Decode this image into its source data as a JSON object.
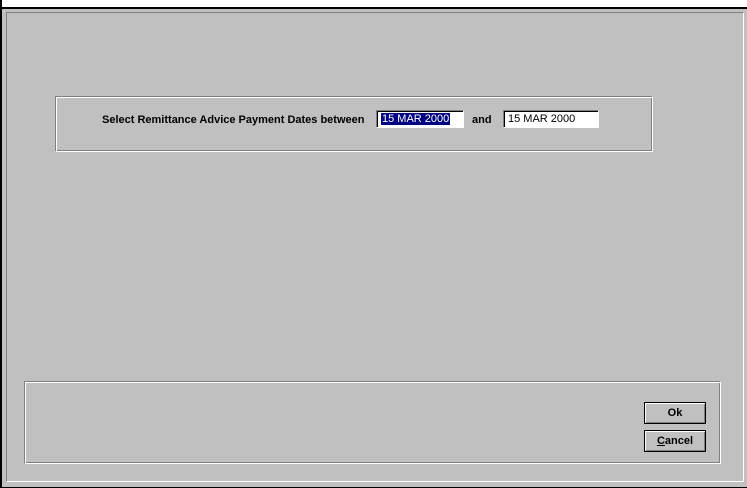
{
  "dialog": {
    "prompt": "Select Remittance Advice Payment Dates between",
    "and_label": "and",
    "date_from": "15 MAR 2000",
    "date_to": "15 MAR 2000"
  },
  "buttons": {
    "ok_label": "Ok",
    "cancel_first": "C",
    "cancel_rest": "ancel"
  }
}
